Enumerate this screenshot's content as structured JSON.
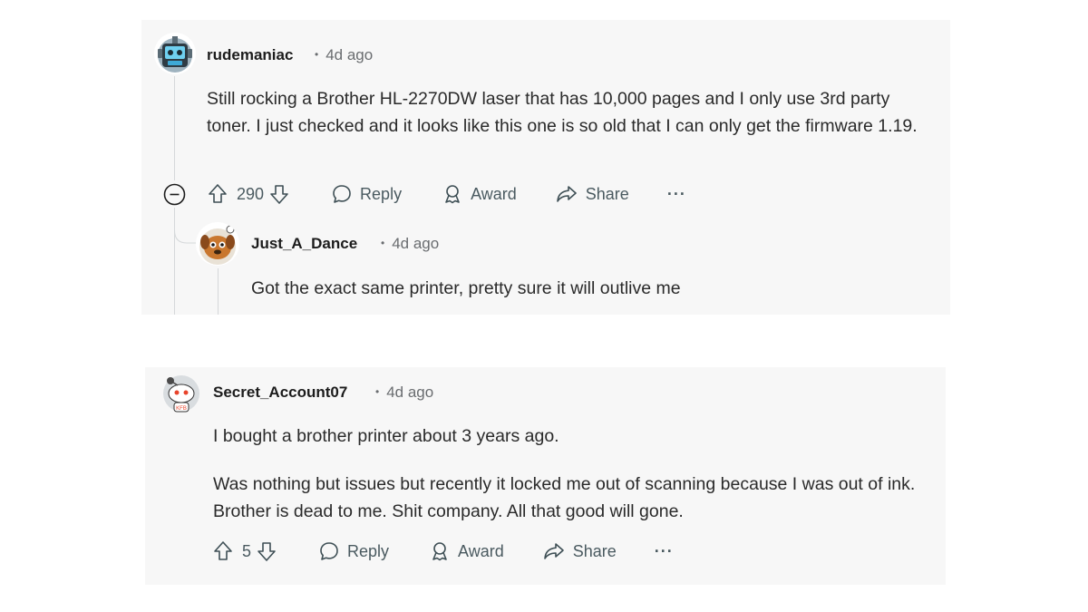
{
  "comments": [
    {
      "username": "rudemaniac",
      "time": "4d ago",
      "body": "Still rocking a Brother HL-2270DW laser that has 10,000 pages and I only use 3rd party toner. I just checked and it looks like this one is so old that I can only get the firmware 1.19.",
      "votes": "290",
      "reply_label": "Reply",
      "award_label": "Award",
      "share_label": "Share",
      "more_label": "···",
      "reply": {
        "username": "Just_A_Dance",
        "time": "4d ago",
        "body": "Got the exact same printer, pretty sure it will outlive me"
      }
    },
    {
      "username": "Secret_Account07",
      "time": "4d ago",
      "body_paragraphs": [
        "I bought a brother printer about 3 years ago.",
        "Was nothing but issues but recently it locked me out of scanning because I was out of ink. Brother is dead to me. Shit company. All that good will gone."
      ],
      "votes": "5",
      "reply_label": "Reply",
      "award_label": "Award",
      "share_label": "Share",
      "more_label": "···"
    }
  ],
  "icons": {
    "collapse": "collapse-icon",
    "upvote": "upvote-icon",
    "downvote": "downvote-icon",
    "reply": "comment-icon",
    "award": "award-icon",
    "share": "share-icon"
  },
  "colors": {
    "card_bg": "#f7f7f7",
    "meta_gray": "#6a6d70",
    "action_gray": "#576f76"
  }
}
